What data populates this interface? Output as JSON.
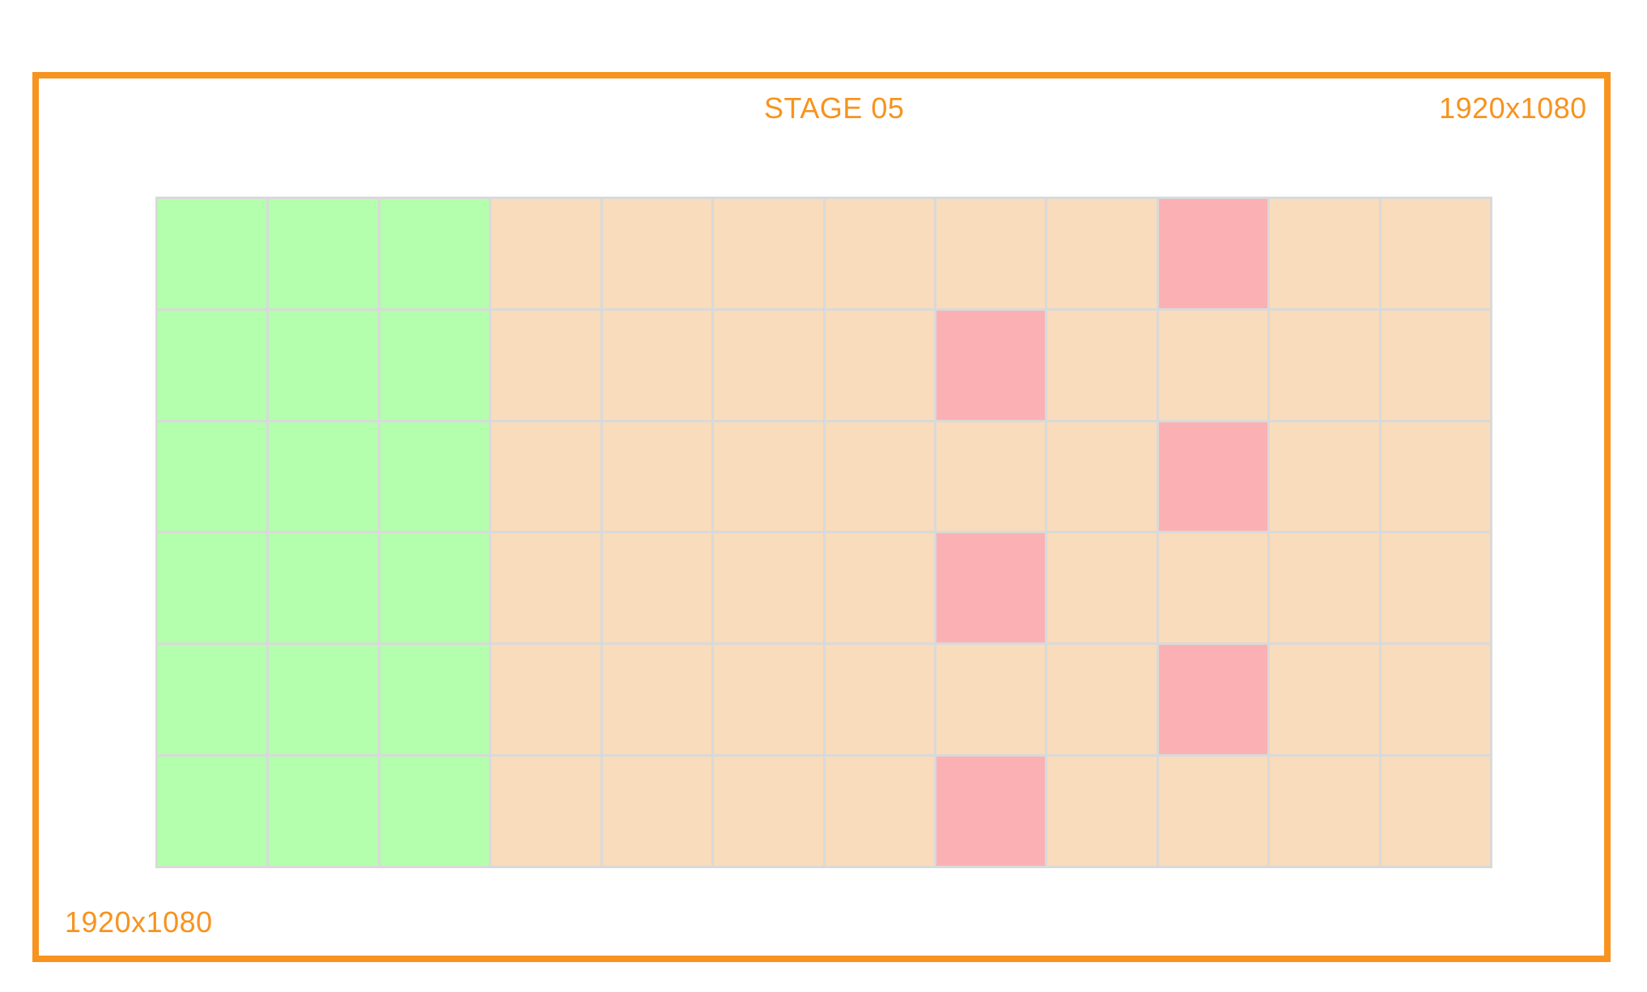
{
  "title": "STAGE 05",
  "resolution_top": "1920x1080",
  "resolution_bottom": "1920x1080",
  "colors": {
    "frame": "#f7931e",
    "green": "#b3ffad",
    "peach": "#f9dcbb",
    "pink": "#fbb1b3",
    "gridline": "#d9d9d9"
  },
  "grid": {
    "columns": 12,
    "rows": [
      [
        "green",
        "green",
        "green",
        "peach",
        "peach",
        "peach",
        "peach",
        "peach",
        "peach",
        "pink",
        "peach",
        "peach"
      ],
      [
        "green",
        "green",
        "green",
        "peach",
        "peach",
        "peach",
        "peach",
        "pink",
        "peach",
        "peach",
        "peach",
        "peach"
      ],
      [
        "green",
        "green",
        "green",
        "peach",
        "peach",
        "peach",
        "peach",
        "peach",
        "peach",
        "pink",
        "peach",
        "peach"
      ],
      [
        "green",
        "green",
        "green",
        "peach",
        "peach",
        "peach",
        "peach",
        "pink",
        "peach",
        "peach",
        "peach",
        "peach"
      ],
      [
        "green",
        "green",
        "green",
        "peach",
        "peach",
        "peach",
        "peach",
        "peach",
        "peach",
        "pink",
        "peach",
        "peach"
      ],
      [
        "green",
        "green",
        "green",
        "peach",
        "peach",
        "peach",
        "peach",
        "pink",
        "peach",
        "peach",
        "peach",
        "peach"
      ]
    ]
  }
}
